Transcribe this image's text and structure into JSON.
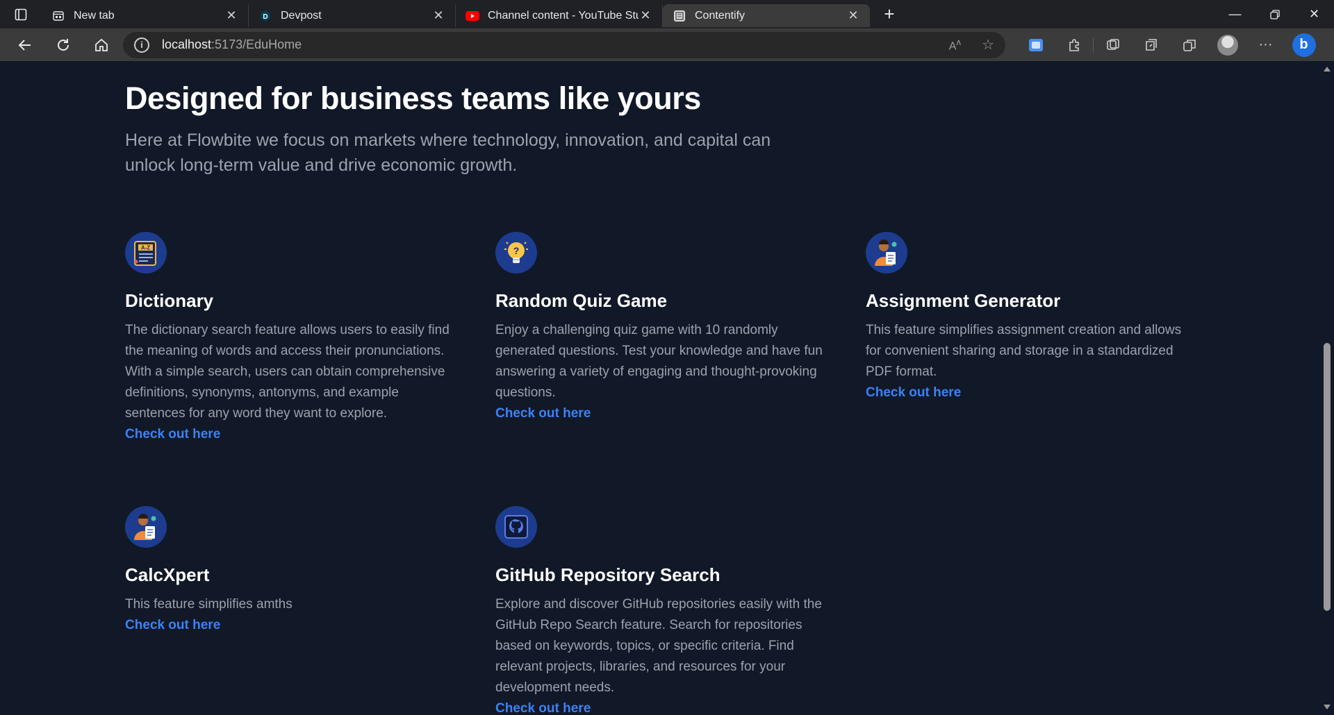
{
  "browser": {
    "tabs": [
      {
        "title": "New tab",
        "icon": "newtab-icon"
      },
      {
        "title": "Devpost",
        "icon": "devpost-icon"
      },
      {
        "title": "Channel content - YouTube Studio",
        "icon": "youtube-icon"
      },
      {
        "title": "Contentify",
        "icon": "contentify-icon"
      }
    ],
    "active_tab": 3,
    "url_host": "localhost",
    "url_path": ":5173/EduHome",
    "read_aloud_label": "A̩"
  },
  "page": {
    "title": "Designed for business teams like yours",
    "subtitle": "Here at Flowbite we focus on markets where technology, innovation, and capital can unlock long-term value and drive economic growth."
  },
  "features": [
    {
      "title": "Dictionary",
      "description": "The dictionary search feature allows users to easily find the meaning of words and access their pronunciations. With a simple search, users can obtain comprehensive definitions, synonyms, antonyms, and example sentences for any word they want to explore.",
      "link": "Check out here",
      "icon": "dictionary-book-icon"
    },
    {
      "title": "Random Quiz Game",
      "description": "Enjoy a challenging quiz game with 10 randomly generated questions. Test your knowledge and have fun answering a variety of engaging and thought-provoking questions.",
      "link": "Check out here",
      "icon": "lightbulb-question-icon"
    },
    {
      "title": "Assignment Generator",
      "description": "This feature simplifies assignment creation and allows for convenient sharing and storage in a standardized PDF format.",
      "link": "Check out here",
      "icon": "person-document-icon"
    },
    {
      "title": "CalcXpert",
      "description": "This feature simplifies amths",
      "link": "Check out here",
      "icon": "person-document-icon"
    },
    {
      "title": "GitHub Repository Search",
      "description": "Explore and discover GitHub repositories easily with the GitHub Repo Search feature. Search for repositories based on keywords, topics, or specific criteria. Find relevant projects, libraries, and resources for your development needs.",
      "link": "Check out here",
      "icon": "github-icon"
    }
  ],
  "colors": {
    "background": "#111827",
    "heading": "#ffffff",
    "body_text": "#9ca3af",
    "link": "#3b82f6",
    "icon_circle": "#1d3c8f"
  }
}
